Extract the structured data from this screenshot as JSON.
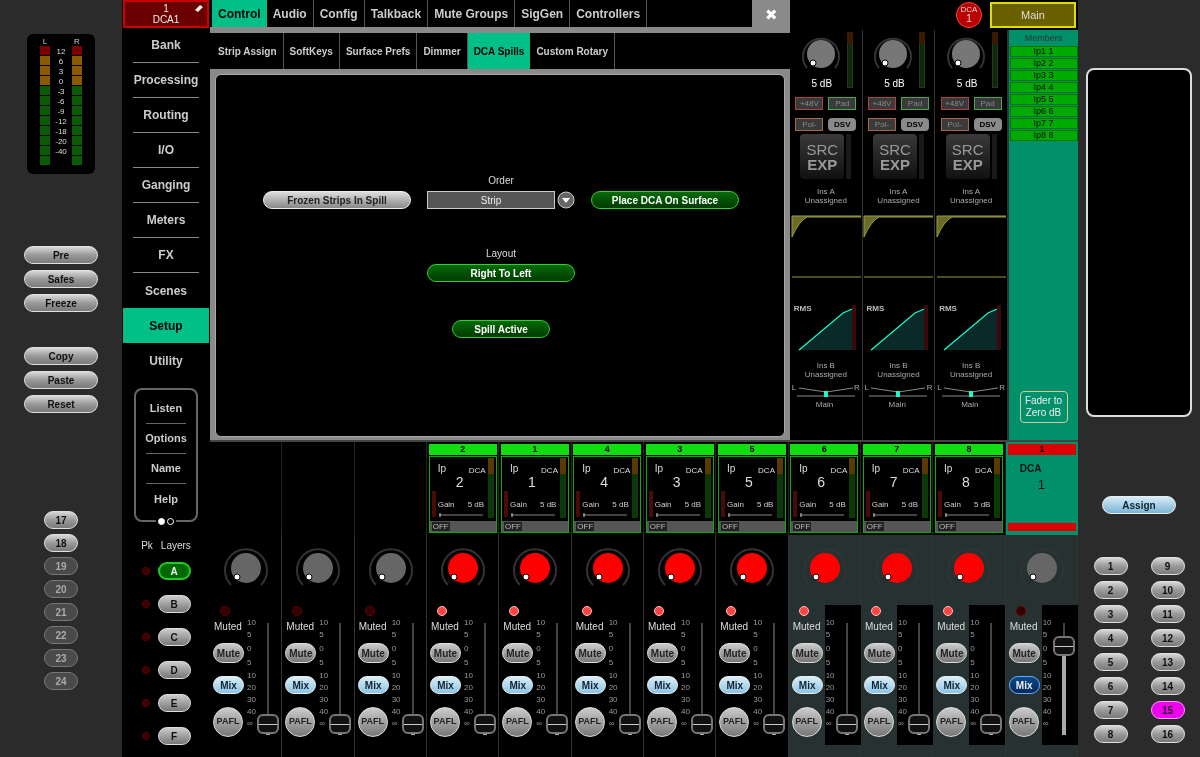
{
  "dca_header": {
    "number": "1",
    "name": "DCA1"
  },
  "left_panel": {
    "meter": {
      "left_label": "L",
      "right_label": "R",
      "scale": [
        "12",
        "6",
        "3",
        "0",
        "-3",
        "-6",
        "-9",
        "-12",
        "-18",
        "-20",
        "-40"
      ]
    },
    "mode_buttons": [
      "Pre",
      "Safes",
      "Freeze"
    ],
    "edit_buttons": [
      "Copy",
      "Paste",
      "Reset"
    ],
    "bank_buttons": [
      {
        "label": "17",
        "disabled": false
      },
      {
        "label": "18",
        "disabled": false
      },
      {
        "label": "19",
        "disabled": true
      },
      {
        "label": "20",
        "disabled": true
      },
      {
        "label": "21",
        "disabled": true
      },
      {
        "label": "22",
        "disabled": true
      },
      {
        "label": "23",
        "disabled": true
      },
      {
        "label": "24",
        "disabled": true
      }
    ]
  },
  "nav": {
    "items": [
      {
        "label": "Bank",
        "selected": false
      },
      {
        "label": "Processing",
        "selected": false
      },
      {
        "label": "Routing",
        "selected": false
      },
      {
        "label": "I/O",
        "selected": false
      },
      {
        "label": "Ganging",
        "selected": false
      },
      {
        "label": "Meters",
        "selected": false
      },
      {
        "label": "FX",
        "selected": false
      },
      {
        "label": "Scenes",
        "selected": false
      },
      {
        "label": "Setup",
        "selected": true
      },
      {
        "label": "Utility",
        "selected": false
      }
    ],
    "sub_items": [
      "Listen",
      "Options",
      "Name",
      "Help"
    ],
    "pager": [
      {
        "selected": true
      },
      {
        "selected": false
      }
    ]
  },
  "layers": {
    "peak_label": "Pk",
    "title": "Layers",
    "items": [
      {
        "label": "A",
        "selected": true
      },
      {
        "label": "B",
        "selected": false
      },
      {
        "label": "C",
        "selected": false
      },
      {
        "label": "D",
        "selected": false
      },
      {
        "label": "E",
        "selected": false
      },
      {
        "label": "F",
        "selected": false
      }
    ]
  },
  "tabs": [
    {
      "label": "Control",
      "selected": true
    },
    {
      "label": "Audio",
      "selected": false
    },
    {
      "label": "Config",
      "selected": false
    },
    {
      "label": "Talkback",
      "selected": false
    },
    {
      "label": "Mute Groups",
      "selected": false
    },
    {
      "label": "SigGen",
      "selected": false
    },
    {
      "label": "Controllers",
      "selected": false
    }
  ],
  "close": "✖",
  "sub_tabs": [
    {
      "label": "Strip Assign",
      "selected": false
    },
    {
      "label": "SoftKeys",
      "selected": false
    },
    {
      "label": "Surface Prefs",
      "selected": false
    },
    {
      "label": "Dimmer",
      "selected": false
    },
    {
      "label": "DCA Spills",
      "selected": true
    },
    {
      "label": "Custom Rotary",
      "selected": false
    }
  ],
  "dca_spills": {
    "frozen_strips": {
      "label": "Frozen Strips In Spill",
      "on": false
    },
    "order": {
      "label": "Order",
      "value": "Strip"
    },
    "place_dca": {
      "label": "Place DCA On Surface",
      "on": true
    },
    "layout": {
      "label": "Layout",
      "value": "Right To Left",
      "on": true
    },
    "spill_active": {
      "label": "Spill Active",
      "on": true
    }
  },
  "dca_badge": {
    "label": "DCA",
    "number": "1"
  },
  "main_button": "Main",
  "channel_detail": [
    {
      "gain": "5 dB",
      "phantom": "+48V",
      "pad": "Pad",
      "polarity": "Pol-",
      "dsv": "DSV",
      "src": "SRC",
      "exp": "EXP",
      "ins_a": "Ins A",
      "ins_a_status": "Unassigned",
      "comp": "RMS",
      "ins_b": "Ins B",
      "ins_b_status": "Unassigned",
      "pan_left": "L",
      "pan_right": "R",
      "pan_bus": "Main"
    },
    {
      "gain": "5 dB",
      "phantom": "+48V",
      "pad": "Pad",
      "polarity": "Pol-",
      "dsv": "DSV",
      "src": "SRC",
      "exp": "EXP",
      "ins_a": "Ins A",
      "ins_a_status": "Unassigned",
      "comp": "RMS",
      "ins_b": "Ins B",
      "ins_b_status": "Unassigned",
      "pan_left": "L",
      "pan_right": "R",
      "pan_bus": "Main"
    },
    {
      "gain": "5 dB",
      "phantom": "+48V",
      "pad": "Pad",
      "polarity": "Pol-",
      "dsv": "DSV",
      "src": "SRC",
      "exp": "EXP",
      "ins_a": "Ins A",
      "ins_a_status": "Unassigned",
      "comp": "RMS",
      "ins_b": "Ins B",
      "ins_b_status": "Unassigned",
      "pan_left": "L",
      "pan_right": "R",
      "pan_bus": "Main"
    }
  ],
  "members": {
    "title": "Members",
    "items": [
      "Ip1 1",
      "Ip2 2",
      "Ip3 3",
      "Ip4 4",
      "Ip5 5",
      "Ip6 6",
      "Ip7 7",
      "Ip8 8"
    ],
    "fader_to_zero": "Fader to Zero dB"
  },
  "assign_button": "Assign",
  "number_buttons": [
    {
      "label": "1",
      "selected": false
    },
    {
      "label": "2",
      "selected": false
    },
    {
      "label": "3",
      "selected": false
    },
    {
      "label": "4",
      "selected": false
    },
    {
      "label": "5",
      "selected": false
    },
    {
      "label": "6",
      "selected": false
    },
    {
      "label": "7",
      "selected": false
    },
    {
      "label": "8",
      "selected": false
    },
    {
      "label": "9",
      "selected": false
    },
    {
      "label": "10",
      "selected": false
    },
    {
      "label": "11",
      "selected": false
    },
    {
      "label": "12",
      "selected": false
    },
    {
      "label": "13",
      "selected": false
    },
    {
      "label": "14",
      "selected": false
    },
    {
      "label": "15",
      "selected": true
    },
    {
      "label": "16",
      "selected": false
    }
  ],
  "strips": [
    {
      "kind": "empty",
      "shaded": false,
      "knob_active": false,
      "led_on": false,
      "muted_label": "Muted",
      "mute": "Mute",
      "mix": "Mix",
      "mix_selected": false,
      "pafl": "PAFL",
      "scale": [
        "10",
        "5",
        "0",
        "5",
        "10",
        "20",
        "30",
        "40",
        "∞"
      ],
      "level": 0
    },
    {
      "kind": "empty",
      "shaded": false,
      "knob_active": false,
      "led_on": false,
      "muted_label": "Muted",
      "mute": "Mute",
      "mix": "Mix",
      "mix_selected": false,
      "pafl": "PAFL",
      "scale": [
        "10",
        "5",
        "0",
        "5",
        "10",
        "20",
        "30",
        "40",
        "∞"
      ],
      "level": 0
    },
    {
      "kind": "empty",
      "shaded": false,
      "knob_active": false,
      "led_on": false,
      "muted_label": "Muted",
      "mute": "Mute",
      "mix": "Mix",
      "mix_selected": false,
      "pafl": "PAFL",
      "scale": [
        "10",
        "5",
        "0",
        "5",
        "10",
        "20",
        "30",
        "40",
        "∞"
      ],
      "level": 0
    },
    {
      "kind": "input",
      "card": {
        "number": "2",
        "source": "Ip",
        "dca": "DCA",
        "channel": "2",
        "gain_label": "Gain",
        "gain": "5 dB",
        "off": "OFF"
      },
      "shaded": false,
      "knob_active": true,
      "led_on": true,
      "muted_label": "Muted",
      "mute": "Mute",
      "mix": "Mix",
      "mix_selected": false,
      "pafl": "PAFL",
      "scale": [
        "10",
        "5",
        "0",
        "5",
        "10",
        "20",
        "30",
        "40",
        "∞"
      ],
      "level": 0
    },
    {
      "kind": "input",
      "card": {
        "number": "1",
        "source": "Ip",
        "dca": "DCA",
        "channel": "1",
        "gain_label": "Gain",
        "gain": "5 dB",
        "off": "OFF"
      },
      "shaded": false,
      "knob_active": true,
      "led_on": true,
      "muted_label": "Muted",
      "mute": "Mute",
      "mix": "Mix",
      "mix_selected": false,
      "pafl": "PAFL",
      "scale": [
        "10",
        "5",
        "0",
        "5",
        "10",
        "20",
        "30",
        "40",
        "∞"
      ],
      "level": 0
    },
    {
      "kind": "input",
      "card": {
        "number": "4",
        "source": "Ip",
        "dca": "DCA",
        "channel": "4",
        "gain_label": "Gain",
        "gain": "5 dB",
        "off": "OFF"
      },
      "shaded": false,
      "knob_active": true,
      "led_on": true,
      "muted_label": "Muted",
      "mute": "Mute",
      "mix": "Mix",
      "mix_selected": false,
      "pafl": "PAFL",
      "scale": [
        "10",
        "5",
        "0",
        "5",
        "10",
        "20",
        "30",
        "40",
        "∞"
      ],
      "level": 0
    },
    {
      "kind": "input",
      "card": {
        "number": "3",
        "source": "Ip",
        "dca": "DCA",
        "channel": "3",
        "gain_label": "Gain",
        "gain": "5 dB",
        "off": "OFF"
      },
      "shaded": false,
      "knob_active": true,
      "led_on": true,
      "muted_label": "Muted",
      "mute": "Mute",
      "mix": "Mix",
      "mix_selected": false,
      "pafl": "PAFL",
      "scale": [
        "10",
        "5",
        "0",
        "5",
        "10",
        "20",
        "30",
        "40",
        "∞"
      ],
      "level": 0
    },
    {
      "kind": "input",
      "card": {
        "number": "5",
        "source": "Ip",
        "dca": "DCA",
        "channel": "5",
        "gain_label": "Gain",
        "gain": "5 dB",
        "off": "OFF"
      },
      "shaded": false,
      "knob_active": true,
      "led_on": true,
      "muted_label": "Muted",
      "mute": "Mute",
      "mix": "Mix",
      "mix_selected": false,
      "pafl": "PAFL",
      "scale": [
        "10",
        "5",
        "0",
        "5",
        "10",
        "20",
        "30",
        "40",
        "∞"
      ],
      "level": 0
    },
    {
      "kind": "input",
      "card": {
        "number": "6",
        "source": "Ip",
        "dca": "DCA",
        "channel": "6",
        "gain_label": "Gain",
        "gain": "5 dB",
        "off": "OFF"
      },
      "shaded": true,
      "knob_active": true,
      "led_on": true,
      "muted_label": "Muted",
      "mute": "Mute",
      "mix": "Mix",
      "mix_selected": false,
      "pafl": "PAFL",
      "scale": [
        "10",
        "5",
        "0",
        "5",
        "10",
        "20",
        "30",
        "40",
        "∞"
      ],
      "level": 0
    },
    {
      "kind": "input",
      "card": {
        "number": "7",
        "source": "Ip",
        "dca": "DCA",
        "channel": "7",
        "gain_label": "Gain",
        "gain": "5 dB",
        "off": "OFF"
      },
      "shaded": true,
      "knob_active": true,
      "led_on": true,
      "muted_label": "Muted",
      "mute": "Mute",
      "mix": "Mix",
      "mix_selected": false,
      "pafl": "PAFL",
      "scale": [
        "10",
        "5",
        "0",
        "5",
        "10",
        "20",
        "30",
        "40",
        "∞"
      ],
      "level": 0
    },
    {
      "kind": "input",
      "card": {
        "number": "8",
        "source": "Ip",
        "dca": "DCA",
        "channel": "8",
        "gain_label": "Gain",
        "gain": "5 dB",
        "off": "OFF"
      },
      "shaded": true,
      "knob_active": true,
      "led_on": true,
      "muted_label": "Muted",
      "mute": "Mute",
      "mix": "Mix",
      "mix_selected": false,
      "pafl": "PAFL",
      "scale": [
        "10",
        "5",
        "0",
        "5",
        "10",
        "20",
        "30",
        "40",
        "∞"
      ],
      "level": 0
    },
    {
      "kind": "dca",
      "card": {
        "number": "1",
        "type": "DCA",
        "channel": "1"
      },
      "shaded": true,
      "knob_active": false,
      "led_on": false,
      "muted_label": "Muted",
      "mute": "Mute",
      "mix": "Mix",
      "mix_selected": true,
      "pafl": "PAFL",
      "scale": [
        "10",
        "5",
        "0",
        "5",
        "10",
        "20",
        "30",
        "40",
        "∞"
      ],
      "level": 0.77
    }
  ]
}
